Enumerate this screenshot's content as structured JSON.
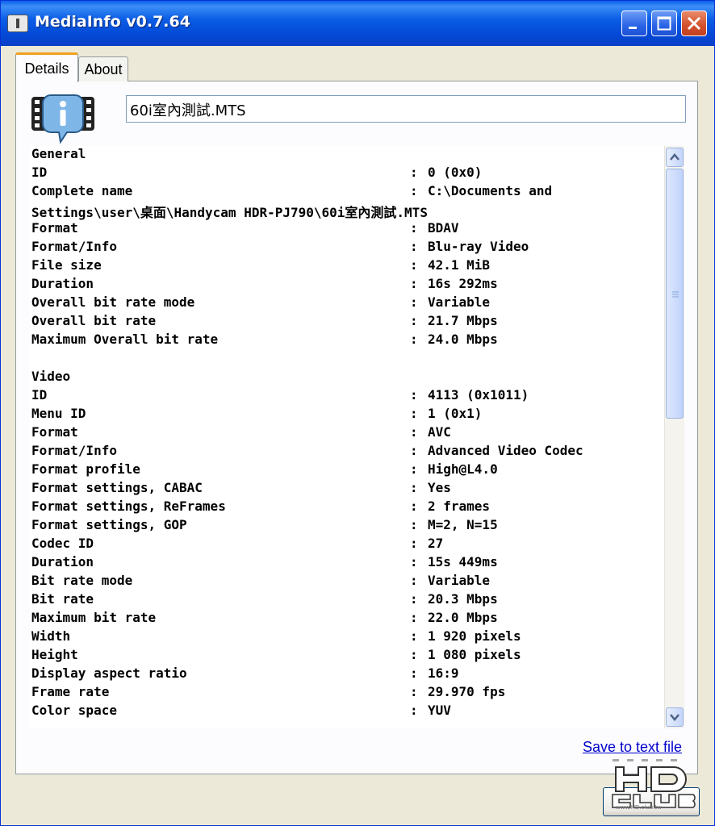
{
  "window": {
    "title": "MediaInfo v0.7.64"
  },
  "tabs": [
    {
      "label": "Details"
    },
    {
      "label": "About"
    }
  ],
  "file": {
    "name": "60i室內測試.MTS"
  },
  "info_rows": [
    {
      "label": "General",
      "sep": "",
      "value": ""
    },
    {
      "label": "ID",
      "sep": ":",
      "value": "0 (0x0)"
    },
    {
      "label": "Complete name",
      "sep": ":",
      "value": "C:\\Documents and"
    },
    {
      "label": "Settings\\user\\桌面\\Handycam HDR-PJ790\\60i室內測試.MTS",
      "sep": "",
      "value": ""
    },
    {
      "label": "Format",
      "sep": ":",
      "value": "BDAV"
    },
    {
      "label": "Format/Info",
      "sep": ":",
      "value": "Blu-ray Video"
    },
    {
      "label": "File size",
      "sep": ":",
      "value": "42.1 MiB"
    },
    {
      "label": "Duration",
      "sep": ":",
      "value": "16s 292ms"
    },
    {
      "label": "Overall bit rate mode",
      "sep": ":",
      "value": "Variable"
    },
    {
      "label": "Overall bit rate",
      "sep": ":",
      "value": "21.7 Mbps"
    },
    {
      "label": "Maximum Overall bit rate",
      "sep": ":",
      "value": "24.0 Mbps"
    },
    {
      "label": "",
      "sep": "",
      "value": ""
    },
    {
      "label": "Video",
      "sep": "",
      "value": ""
    },
    {
      "label": "ID",
      "sep": ":",
      "value": "4113 (0x1011)"
    },
    {
      "label": "Menu ID",
      "sep": ":",
      "value": "1 (0x1)"
    },
    {
      "label": "Format",
      "sep": ":",
      "value": "AVC"
    },
    {
      "label": "Format/Info",
      "sep": ":",
      "value": "Advanced Video Codec"
    },
    {
      "label": "Format profile",
      "sep": ":",
      "value": "High@L4.0"
    },
    {
      "label": "Format settings, CABAC",
      "sep": ":",
      "value": "Yes"
    },
    {
      "label": "Format settings, ReFrames",
      "sep": ":",
      "value": "2 frames"
    },
    {
      "label": "Format settings, GOP",
      "sep": ":",
      "value": "M=2, N=15"
    },
    {
      "label": "Codec ID",
      "sep": ":",
      "value": "27"
    },
    {
      "label": "Duration",
      "sep": ":",
      "value": "15s 449ms"
    },
    {
      "label": "Bit rate mode",
      "sep": ":",
      "value": "Variable"
    },
    {
      "label": "Bit rate",
      "sep": ":",
      "value": "20.3 Mbps"
    },
    {
      "label": "Maximum bit rate",
      "sep": ":",
      "value": "22.0 Mbps"
    },
    {
      "label": "Width",
      "sep": ":",
      "value": "1 920 pixels"
    },
    {
      "label": "Height",
      "sep": ":",
      "value": "1 080 pixels"
    },
    {
      "label": "Display aspect ratio",
      "sep": ":",
      "value": "16:9"
    },
    {
      "label": "Frame rate",
      "sep": ":",
      "value": "29.970 fps"
    },
    {
      "label": "Color space",
      "sep": ":",
      "value": "YUV"
    }
  ],
  "actions": {
    "save_label": "Save to text file"
  },
  "watermark": {
    "text": "www.HD.club.tw"
  },
  "colors": {
    "titlebar": "#0349d6",
    "link": "#0000cc",
    "tab_accent": "#f0a020"
  },
  "icons": [
    "mediainfo-app-icon",
    "minimize-icon",
    "maximize-icon",
    "close-icon",
    "mediainfo-logo-icon",
    "scroll-up-arrow-icon",
    "scroll-down-arrow-icon",
    "hdclub-watermark-logo"
  ]
}
